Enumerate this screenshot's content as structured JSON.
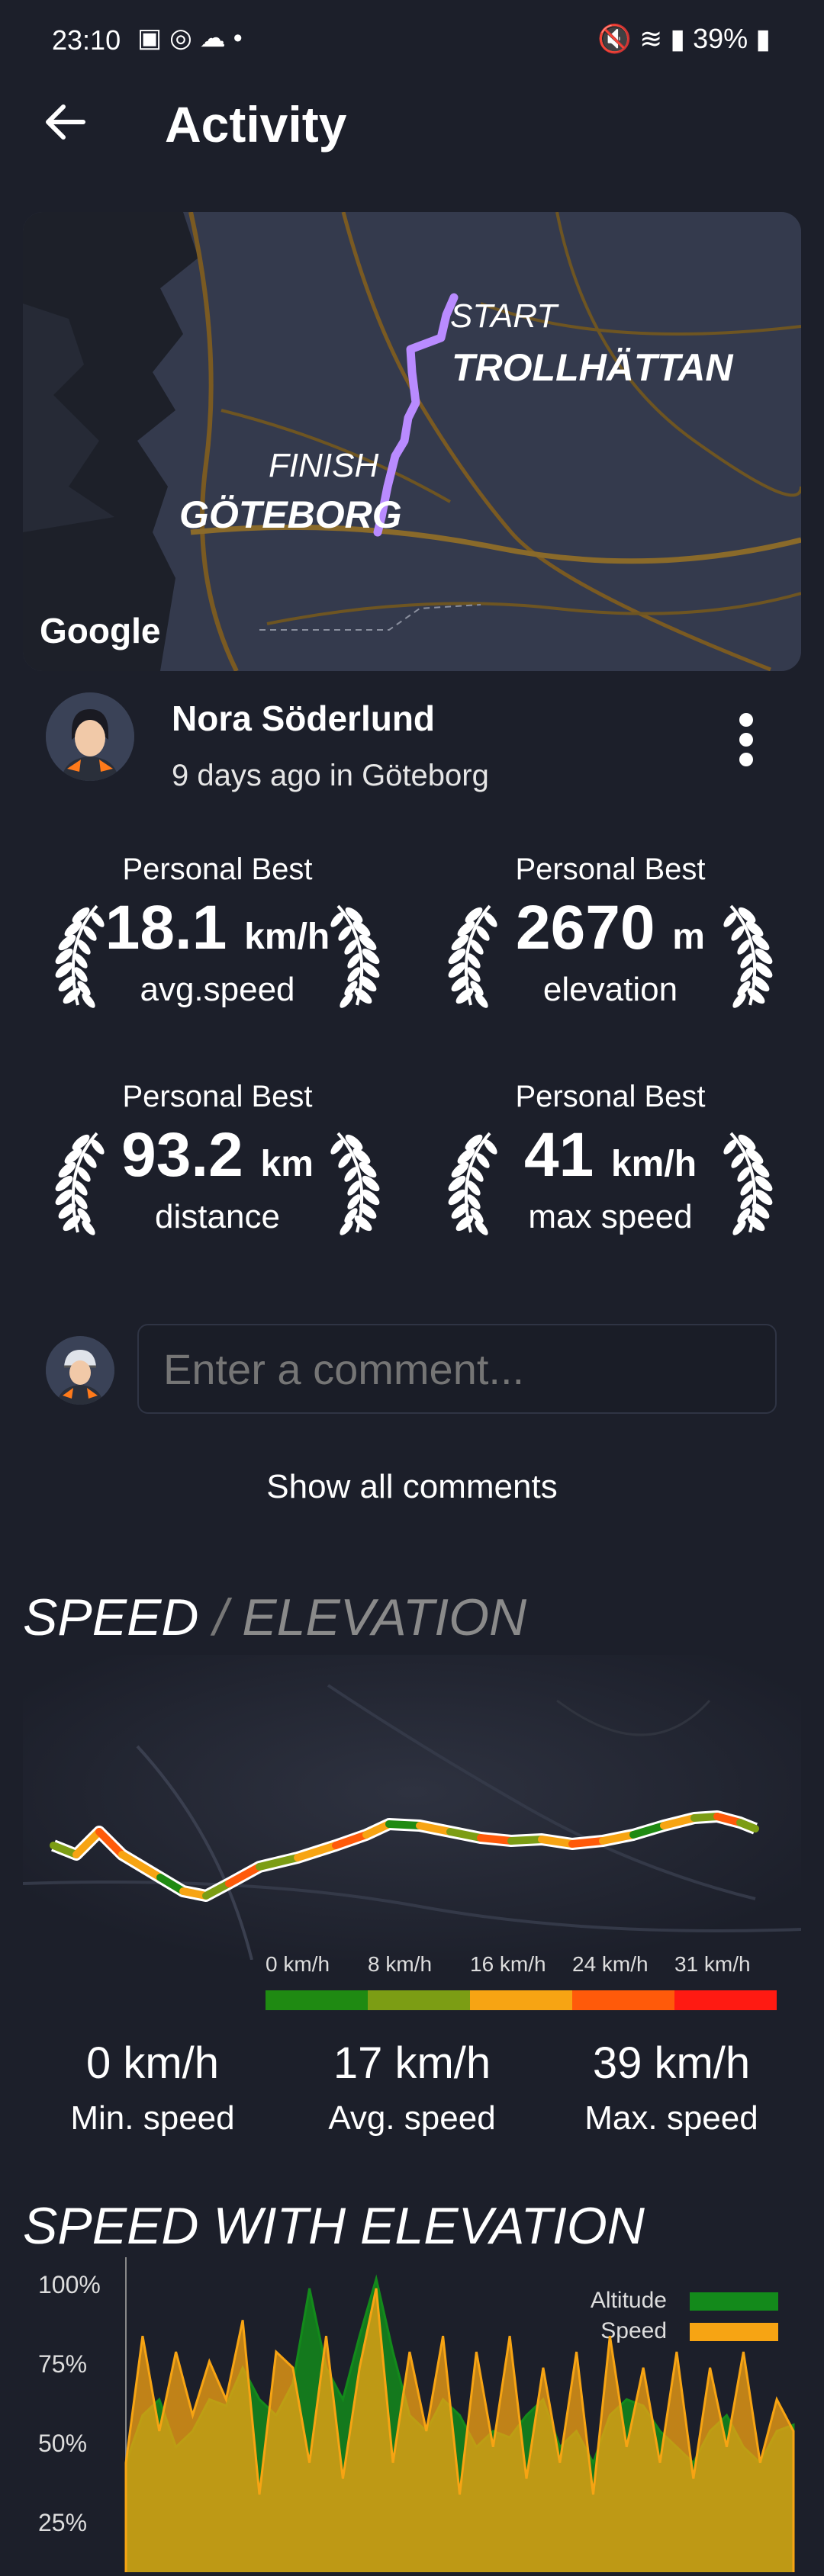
{
  "status": {
    "time": "23:10",
    "battery": "39%"
  },
  "header": {
    "title": "Activity"
  },
  "map": {
    "start_label": "START",
    "start_city": "TROLLHÄTTAN",
    "finish_label": "FINISH",
    "finish_city": "GÖTEBORG",
    "attribution": "Google",
    "route_color": "#b98bff"
  },
  "user": {
    "name": "Nora Söderlund",
    "subtitle": "9 days ago in Göteborg"
  },
  "personal_bests": [
    {
      "label": "Personal Best",
      "value": "18.1",
      "unit": "km/h",
      "caption": "avg.speed"
    },
    {
      "label": "Personal Best",
      "value": "2670",
      "unit": "m",
      "caption": "elevation"
    },
    {
      "label": "Personal Best",
      "value": "93.2",
      "unit": "km",
      "caption": "distance"
    },
    {
      "label": "Personal Best",
      "value": "41",
      "unit": "km/h",
      "caption": "max speed"
    }
  ],
  "comment": {
    "placeholder": "Enter a comment...",
    "show_all": "Show all comments"
  },
  "speed_section": {
    "title_a": "SPEED",
    "sep": "/",
    "title_b": "ELEVATION",
    "legend": [
      "0 km/h",
      "8 km/h",
      "16 km/h",
      "24 km/h",
      "31 km/h"
    ],
    "legend_colors": [
      "#1f8a12",
      "#7c9d14",
      "#f7a413",
      "#ff5a0a",
      "#ff1a12"
    ],
    "stats": [
      {
        "value": "0 km/h",
        "label": "Min. speed"
      },
      {
        "value": "17 km/h",
        "label": "Avg. speed"
      },
      {
        "value": "39 km/h",
        "label": "Max. speed"
      }
    ]
  },
  "elevation_chart": {
    "title": "SPEED WITH ELEVATION",
    "y_ticks": [
      "100%",
      "75%",
      "50%",
      "25%"
    ],
    "legend": [
      {
        "name": "Altitude",
        "color": "#138a1b"
      },
      {
        "name": "Speed",
        "color": "#f7a413"
      }
    ]
  },
  "chart_data": {
    "type": "area",
    "title": "SPEED WITH ELEVATION",
    "ylim": [
      0,
      100
    ],
    "series": [
      {
        "name": "Altitude",
        "values": [
          40,
          55,
          60,
          45,
          50,
          60,
          58,
          70,
          60,
          55,
          65,
          95,
          70,
          60,
          80,
          98,
          75,
          55,
          50,
          60,
          55,
          45,
          50,
          48,
          55,
          60,
          45,
          50,
          40,
          55,
          60,
          58,
          50,
          45,
          40,
          50,
          55,
          45,
          40,
          50,
          52
        ]
      },
      {
        "name": "Speed",
        "values": [
          40,
          80,
          50,
          75,
          55,
          72,
          60,
          85,
          30,
          75,
          70,
          40,
          80,
          35,
          70,
          95,
          40,
          75,
          50,
          80,
          30,
          75,
          45,
          80,
          35,
          70,
          40,
          75,
          30,
          80,
          45,
          70,
          40,
          75,
          35,
          70,
          45,
          75,
          40,
          60,
          50
        ]
      }
    ]
  }
}
